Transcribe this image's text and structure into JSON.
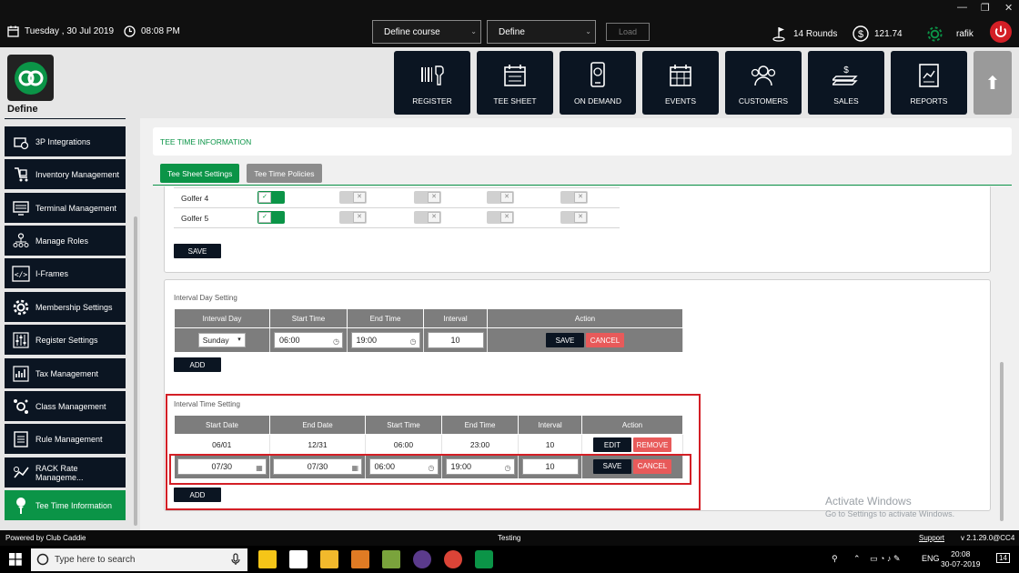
{
  "topbar": {
    "date": "Tuesday ,  30 Jul 2019",
    "time": "08:08 PM",
    "course_select": "Define course",
    "define_select": "Define",
    "load_label": "Load",
    "rounds": "14 Rounds",
    "balance": "121.74",
    "user": "rafik"
  },
  "brand": {
    "name": "Define",
    "accent": "#0b9447",
    "dark": "#0b1522",
    "danger": "#e85a5a"
  },
  "nav": [
    {
      "label": "REGISTER",
      "icon": "barcode-scanner-icon"
    },
    {
      "label": "TEE SHEET",
      "icon": "calendar-icon"
    },
    {
      "label": "ON DEMAND",
      "icon": "mobile-icon"
    },
    {
      "label": "EVENTS",
      "icon": "calendar-grid-icon"
    },
    {
      "label": "CUSTOMERS",
      "icon": "users-icon"
    },
    {
      "label": "SALES",
      "icon": "money-icon"
    },
    {
      "label": "REPORTS",
      "icon": "report-icon"
    }
  ],
  "sidebar": {
    "items": [
      {
        "label": "3P Integrations",
        "icon": "integration-icon"
      },
      {
        "label": "Inventory Management",
        "icon": "inventory-icon"
      },
      {
        "label": "Terminal Management",
        "icon": "terminal-icon"
      },
      {
        "label": "Manage Roles",
        "icon": "roles-icon"
      },
      {
        "label": "I-Frames",
        "icon": "code-icon"
      },
      {
        "label": "Membership Settings",
        "icon": "gear-icon"
      },
      {
        "label": "Register Settings",
        "icon": "sliders-icon"
      },
      {
        "label": "Tax Management",
        "icon": "tax-icon"
      },
      {
        "label": "Class Management",
        "icon": "class-icon"
      },
      {
        "label": "Rule Management",
        "icon": "rule-icon"
      },
      {
        "label": "RACK Rate Manageme...",
        "icon": "rack-rate-icon"
      },
      {
        "label": "Tee Time Information",
        "icon": "golf-tee-icon"
      }
    ]
  },
  "main": {
    "title": "TEE TIME INFORMATION",
    "tabs": [
      "Tee Sheet Settings",
      "Tee Time Policies"
    ],
    "golfers": {
      "rows": [
        {
          "name": "Golfer 4",
          "toggles": [
            true,
            false,
            false,
            false,
            false
          ]
        },
        {
          "name": "Golfer 5",
          "toggles": [
            true,
            false,
            false,
            false,
            false
          ]
        }
      ],
      "save_label": "SAVE"
    },
    "interval_day": {
      "label": "Interval Day Setting",
      "headers": [
        "Interval Day",
        "Start Time",
        "End Time",
        "Interval",
        "Action"
      ],
      "day": "Sunday",
      "start": "06:00",
      "end": "19:00",
      "interval": "10",
      "save_label": "SAVE",
      "cancel_label": "CANCEL",
      "add_label": "ADD"
    },
    "interval_time": {
      "label": "Interval Time Setting",
      "headers": [
        "Start Date",
        "End Date",
        "Start Time",
        "End Time",
        "Interval",
        "Action"
      ],
      "row": {
        "start_date": "06/01",
        "end_date": "12/31",
        "start_time": "06:00",
        "end_time": "23:00",
        "interval": "10"
      },
      "edit_label": "EDIT",
      "remove_label": "REMOVE",
      "edit_row": {
        "start_date": "07/30",
        "end_date": "07/30",
        "start_time": "06:00",
        "end_time": "19:00",
        "interval": "10"
      },
      "save_label": "SAVE",
      "cancel_label": "CANCEL",
      "add_label": "ADD"
    }
  },
  "watermark": {
    "line1": "Activate Windows",
    "line2": "Go to Settings to activate Windows."
  },
  "footer": {
    "powered": "Powered by Club Caddie",
    "env": "Testing",
    "support": "Support",
    "version": "v 2.1.29.0@CC4"
  },
  "taskbar": {
    "search_placeholder": "Type here to search",
    "lang": "ENG",
    "time": "20:08",
    "date": "30-07-2019",
    "notif_count": "14"
  }
}
